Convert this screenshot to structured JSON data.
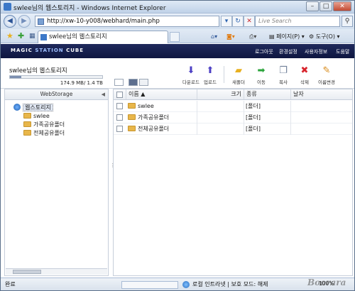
{
  "window": {
    "title": "swlee님의 웹스토리지 - Windows Internet Explorer"
  },
  "address_bar": {
    "url": "http://xw-10-y008/webhard/main.php",
    "search_placeholder": "Live Search"
  },
  "tabs": [
    {
      "label": "swlee님의 웹스토리지"
    }
  ],
  "command_bar": {
    "page_label": "페이지(P)",
    "tools_label": "도구(O)"
  },
  "app": {
    "logo_prefix": "MAGIC",
    "logo_accent": "STATION",
    "logo_suffix": "CUBE",
    "nav": [
      "로그아웃",
      "환경설정",
      "사용자정보",
      "도움말"
    ]
  },
  "storage": {
    "title": "swlee님의 웹스토리지",
    "usage_text": "174.9 MB/ 1.4 TB",
    "usage_fraction": 0.12
  },
  "toolbar": {
    "download": "다운로드",
    "upload": "업로드",
    "new_folder": "새폴더",
    "move": "이동",
    "copy": "복사",
    "delete": "삭제",
    "rename": "이름변경"
  },
  "tree": {
    "header": "WebStorage",
    "root": "웹스토리지",
    "children": [
      "swlee",
      "가족공유폴더",
      "전체공유폴더"
    ]
  },
  "grid": {
    "columns": {
      "name": "이름 ▲",
      "size": "크기",
      "type": "종류",
      "date": "날자"
    },
    "rows": [
      {
        "name": "swlee",
        "size": "",
        "type": "[폴더]",
        "date": ""
      },
      {
        "name": "가족공유폴더",
        "size": "",
        "type": "[폴더]",
        "date": ""
      },
      {
        "name": "전체공유폴더",
        "size": "",
        "type": "[폴더]",
        "date": ""
      }
    ]
  },
  "status": {
    "left": "완료",
    "zone": "로컬 인트라넷 | 보호 모드: 해제",
    "zoom": "100%"
  },
  "watermark": "Boorara",
  "colors": {
    "app_header": "#0e1640",
    "download_icon": "#4c3fc4",
    "move_icon": "#2aa33a",
    "delete_icon": "#d8242c",
    "rename_icon": "#d88a18",
    "folder": "#e8b64a"
  }
}
